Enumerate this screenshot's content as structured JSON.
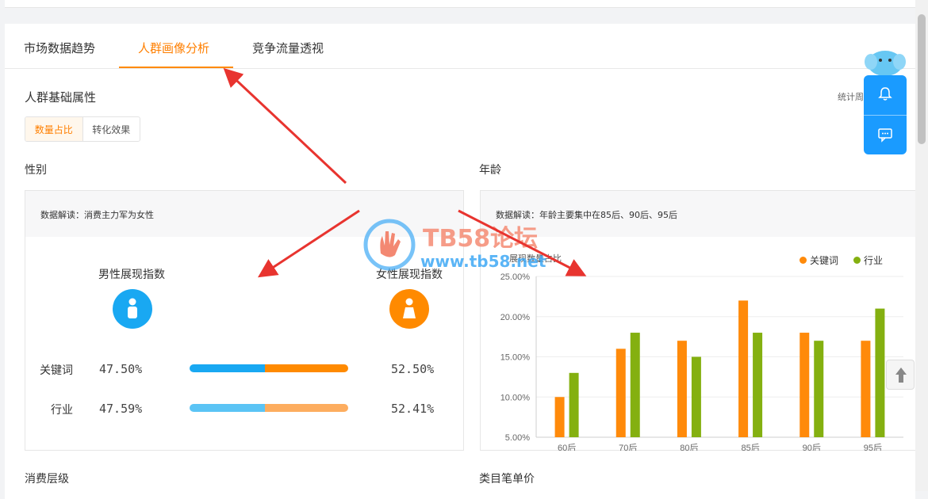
{
  "tabs": [
    {
      "label": "市场数据趋势",
      "active": false
    },
    {
      "label": "人群画像分析",
      "active": true
    },
    {
      "label": "竞争流量透视",
      "active": false
    }
  ],
  "section_title": "人群基础属性",
  "stat_period": "统计周期：近7天",
  "toggle": {
    "left": "数量占比",
    "right": "转化效果"
  },
  "gender": {
    "label": "性别",
    "insight": "数据解读：消费主力军为女性",
    "male_title": "男性展现指数",
    "female_title": "女性展现指数",
    "rows": [
      {
        "label": "关键词",
        "male": "47.50%",
        "female": "52.50%",
        "male_share": 0.475
      },
      {
        "label": "行业",
        "male": "47.59%",
        "female": "52.41%",
        "male_share": 0.4759
      }
    ],
    "colors": {
      "male": "#19a8f2",
      "female": "#ff8a00",
      "male_light": "#5bc4f5",
      "female_light": "#fdad5f"
    }
  },
  "age": {
    "label": "年龄",
    "insight": "数据解读：年龄主要集中在85后、90后、95后",
    "chart_title": "展现数量占比"
  },
  "chart_data": {
    "type": "bar",
    "title": "展现数量占比",
    "categories": [
      "60后",
      "70后",
      "80后",
      "85后",
      "90后",
      "95后"
    ],
    "series": [
      {
        "name": "关键词",
        "color": "#ff8a0a",
        "values": [
          10,
          16,
          17,
          22,
          18,
          17
        ]
      },
      {
        "name": "行业",
        "color": "#84b010",
        "values": [
          13,
          18,
          15,
          18,
          17,
          21
        ]
      }
    ],
    "yticks": [
      "5.00%",
      "10.00%",
      "15.00%",
      "20.00%",
      "25.00%"
    ],
    "ylim": [
      5,
      25
    ],
    "legend": "top-right",
    "grid": true
  },
  "bottom": {
    "left": "消费层级",
    "right": "类目笔单价"
  },
  "watermark": {
    "title": "TB58论坛",
    "url": "www.tb58.net"
  }
}
